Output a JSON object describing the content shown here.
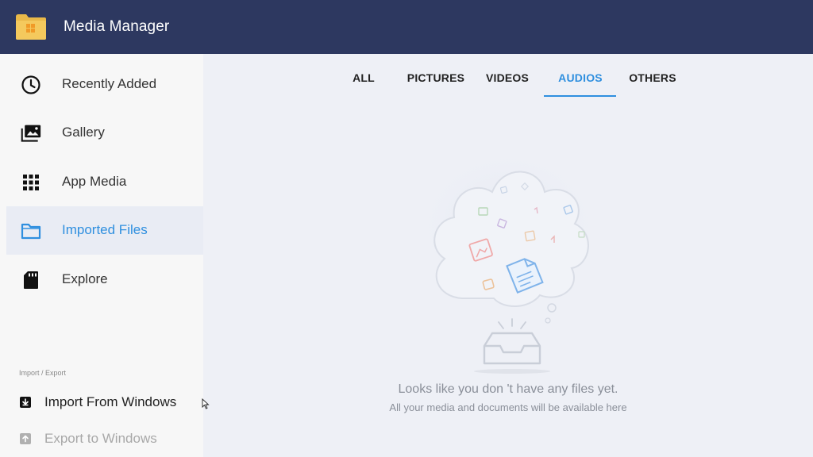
{
  "app": {
    "title": "Media Manager"
  },
  "sidebar": {
    "items": [
      {
        "label": "Recently Added",
        "icon": "clock-icon"
      },
      {
        "label": "Gallery",
        "icon": "gallery-icon"
      },
      {
        "label": "App Media",
        "icon": "grid-icon"
      },
      {
        "label": "Imported Files",
        "icon": "folder-icon",
        "active": true
      },
      {
        "label": "Explore",
        "icon": "sd-card-icon"
      }
    ],
    "section_label": "Import / Export",
    "import_label": "Import From Windows",
    "export_label": "Export to Windows"
  },
  "tabs": [
    {
      "label": "ALL"
    },
    {
      "label": "PICTURES"
    },
    {
      "label": "VIDEOS"
    },
    {
      "label": "AUDIOS",
      "active": true
    },
    {
      "label": "OTHERS"
    }
  ],
  "empty_state": {
    "title": "Looks like you don 't have any files yet.",
    "subtitle": "All your media and documents will be available here"
  },
  "colors": {
    "titlebar": "#2d3860",
    "accent": "#2f8fdf",
    "sidebar_bg": "#f7f7f7",
    "main_bg": "#eef0f6"
  }
}
